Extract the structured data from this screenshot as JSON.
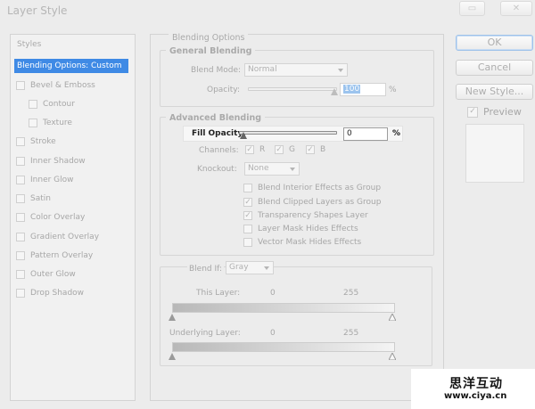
{
  "window": {
    "title": "Layer Style"
  },
  "styles_panel": {
    "header": "Styles",
    "selected": "Blending Options: Custom",
    "items": [
      {
        "label": "Bevel & Emboss",
        "indent": false,
        "checked": false
      },
      {
        "label": "Contour",
        "indent": true,
        "checked": false
      },
      {
        "label": "Texture",
        "indent": true,
        "checked": false
      },
      {
        "label": "Stroke",
        "indent": false,
        "checked": false
      },
      {
        "label": "Inner Shadow",
        "indent": false,
        "checked": false
      },
      {
        "label": "Inner Glow",
        "indent": false,
        "checked": false
      },
      {
        "label": "Satin",
        "indent": false,
        "checked": false
      },
      {
        "label": "Color Overlay",
        "indent": false,
        "checked": false
      },
      {
        "label": "Gradient Overlay",
        "indent": false,
        "checked": false
      },
      {
        "label": "Pattern Overlay",
        "indent": false,
        "checked": false
      },
      {
        "label": "Outer Glow",
        "indent": false,
        "checked": false
      },
      {
        "label": "Drop Shadow",
        "indent": false,
        "checked": false
      }
    ]
  },
  "blending": {
    "section_title": "Blending Options",
    "general_title": "General Blending",
    "blend_mode_label": "Blend Mode:",
    "blend_mode_value": "Normal",
    "opacity_label": "Opacity:",
    "opacity_value": "100",
    "percent": "%",
    "advanced_title": "Advanced Blending",
    "fill_opacity_label": "Fill Opacity:",
    "fill_opacity_value": "0",
    "channels_label": "Channels:",
    "channels": [
      {
        "label": "R",
        "checked": true
      },
      {
        "label": "G",
        "checked": true
      },
      {
        "label": "B",
        "checked": true
      }
    ],
    "knockout_label": "Knockout:",
    "knockout_value": "None",
    "options": [
      {
        "label": "Blend Interior Effects as Group",
        "checked": false
      },
      {
        "label": "Blend Clipped Layers as Group",
        "checked": true
      },
      {
        "label": "Transparency Shapes Layer",
        "checked": true
      },
      {
        "label": "Layer Mask Hides Effects",
        "checked": false
      },
      {
        "label": "Vector Mask Hides Effects",
        "checked": false
      }
    ],
    "blend_if_label": "Blend If:",
    "blend_if_value": "Gray",
    "this_layer_label": "This Layer:",
    "this_layer_min": "0",
    "this_layer_max": "255",
    "underlying_label": "Underlying Layer:",
    "underlying_min": "0",
    "underlying_max": "255"
  },
  "buttons": {
    "ok": "OK",
    "cancel": "Cancel",
    "new_style": "New Style...",
    "preview": "Preview"
  },
  "watermark": {
    "cn": "思洋互动",
    "url": "www.ciya.cn"
  }
}
